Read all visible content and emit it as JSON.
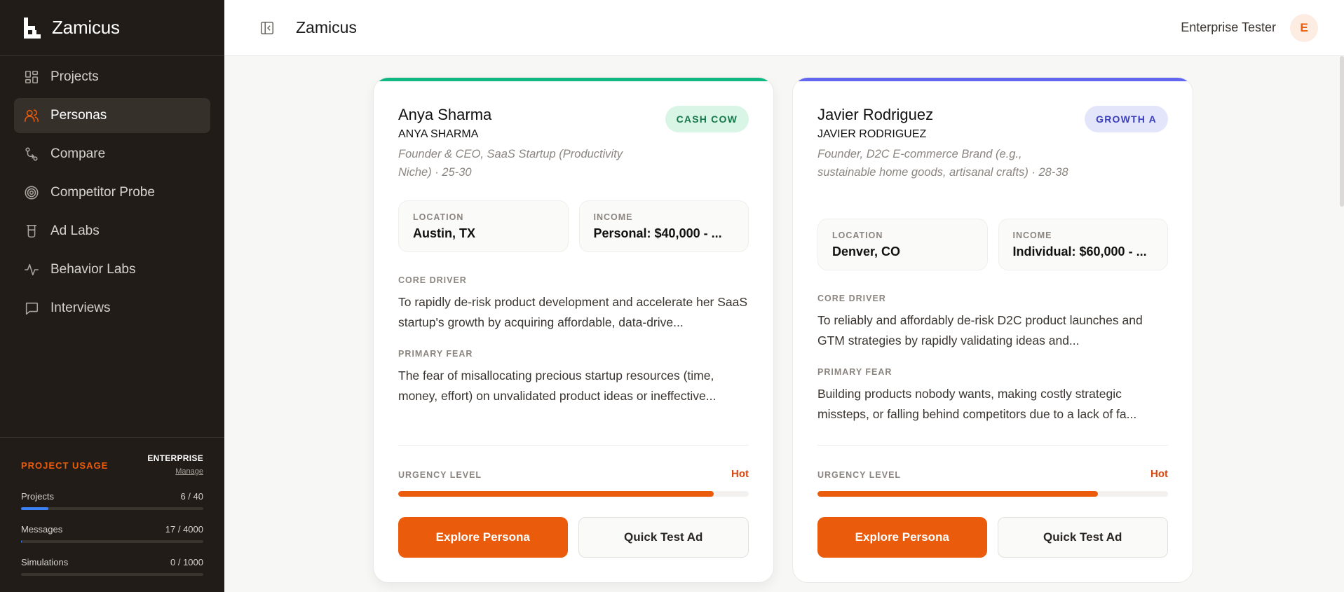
{
  "app": {
    "name": "Zamicus"
  },
  "nav": {
    "items": [
      {
        "label": "Projects",
        "icon": "grid-icon",
        "active": false
      },
      {
        "label": "Personas",
        "icon": "users-icon",
        "active": true
      },
      {
        "label": "Compare",
        "icon": "compare-icon",
        "active": false
      },
      {
        "label": "Competitor Probe",
        "icon": "target-icon",
        "active": false
      },
      {
        "label": "Ad Labs",
        "icon": "beaker-icon",
        "active": false
      },
      {
        "label": "Behavior Labs",
        "icon": "activity-icon",
        "active": false
      },
      {
        "label": "Interviews",
        "icon": "chat-icon",
        "active": false
      }
    ]
  },
  "usage": {
    "title": "PROJECT USAGE",
    "plan": "ENTERPRISE",
    "manage": "Manage",
    "meters": [
      {
        "label": "Projects",
        "value": "6 / 40",
        "fraction": 0.15
      },
      {
        "label": "Messages",
        "value": "17 / 4000",
        "fraction": 0.004
      },
      {
        "label": "Simulations",
        "value": "0 / 1000",
        "fraction": 0
      }
    ]
  },
  "header": {
    "title": "Zamicus",
    "user_name": "Enterprise Tester",
    "avatar_initial": "E"
  },
  "cards": [
    {
      "name": "Anya Sharma",
      "name_upper": "ANYA SHARMA",
      "role": "Founder & CEO, SaaS Startup (Productivity Niche) · 25-30",
      "badge": "CASH COW",
      "accent": "#10b981",
      "location_label": "LOCATION",
      "location": "Austin, TX",
      "income_label": "INCOME",
      "income": "Personal: $40,000 - ...",
      "core_driver_label": "CORE DRIVER",
      "core_driver": "To rapidly de-risk product development and accelerate her SaaS startup's growth by acquiring affordable, data-drive...",
      "primary_fear_label": "PRIMARY FEAR",
      "primary_fear": "The fear of misallocating precious startup resources (time, money, effort) on unvalidated product ideas or ineffective...",
      "urgency_label": "URGENCY LEVEL",
      "urgency": "Hot",
      "urgency_fraction": 0.9,
      "explore": "Explore Persona",
      "quick_test": "Quick Test Ad"
    },
    {
      "name": "Javier Rodriguez",
      "name_upper": "JAVIER RODRIGUEZ",
      "role": "Founder, D2C E-commerce Brand (e.g., sustainable home goods, artisanal crafts) · 28-38",
      "badge": "GROWTH A",
      "accent": "#6366f1",
      "location_label": "LOCATION",
      "location": "Denver, CO",
      "income_label": "INCOME",
      "income": "Individual: $60,000 - ...",
      "core_driver_label": "CORE DRIVER",
      "core_driver": "To reliably and affordably de-risk D2C product launches and GTM strategies by rapidly validating ideas and...",
      "primary_fear_label": "PRIMARY FEAR",
      "primary_fear": "Building products nobody wants, making costly strategic missteps, or falling behind competitors due to a lack of fa...",
      "urgency_label": "URGENCY LEVEL",
      "urgency": "Hot",
      "urgency_fraction": 0.8,
      "explore": "Explore Persona",
      "quick_test": "Quick Test Ad"
    }
  ]
}
